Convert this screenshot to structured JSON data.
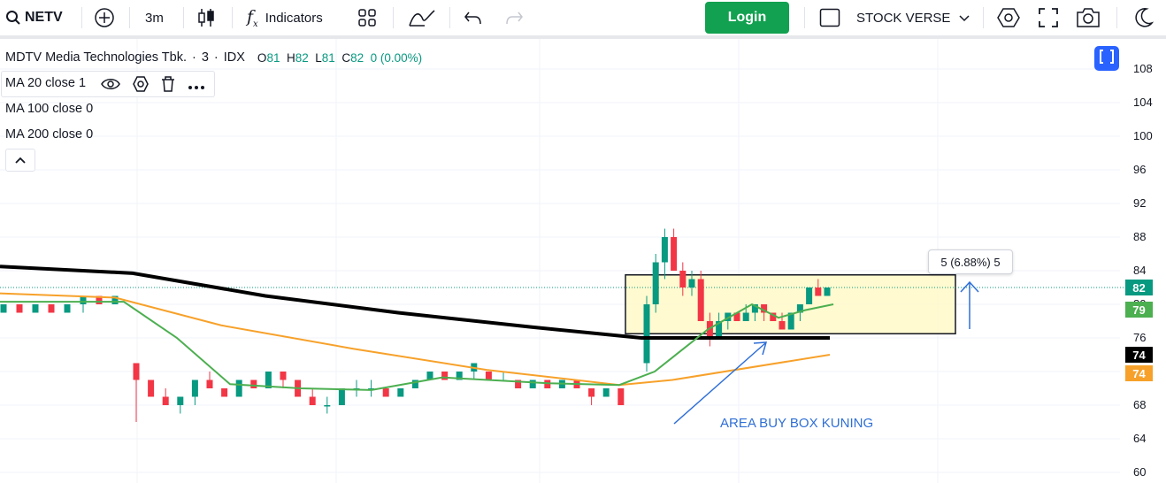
{
  "toolbar": {
    "symbol": "NETV",
    "interval": "3m",
    "indicators_label": "Indicators",
    "login_label": "Login",
    "layout_name": "STOCK VERSE",
    "icons": [
      "search-icon",
      "add-symbol-icon",
      "candles-icon",
      "fx-icon",
      "templates-icon",
      "drawing-icon",
      "undo-icon",
      "redo-icon",
      "square-icon",
      "chevron-down-icon",
      "settings-hexagon-icon",
      "fullscreen-icon",
      "camera-icon",
      "theme-moon-icon"
    ]
  },
  "legend": {
    "name": "MDTV Media Technologies Tbk.",
    "sep1": "·",
    "interval": "3",
    "sep2": "·",
    "exchange": "IDX",
    "o_key": "O",
    "o_val": "81",
    "h_key": "H",
    "h_val": "82",
    "l_key": "L",
    "l_val": "81",
    "c_key": "C",
    "c_val": "82",
    "change": "0 (0.00%)",
    "ma1": "MA 20 close 1",
    "ma2": "MA 100 close 0",
    "ma3": "MA 200 close 0"
  },
  "price_axis": [
    "108",
    "104",
    "100",
    "96",
    "92",
    "88",
    "84",
    "80",
    "76",
    "72",
    "68",
    "64",
    "60"
  ],
  "badges": {
    "last": "82",
    "ma20": "79",
    "ma200": "74",
    "ma100": "74"
  },
  "colors": {
    "up": "#089981",
    "down": "#f23645",
    "ma20": "#4caf50",
    "ma100": "#f7a12a",
    "ma200": "#000000",
    "box_fill": "#fff9c4",
    "annotation": "#2f6fd6",
    "login": "#12a150"
  },
  "measure_label": "5 (6.88%) 5",
  "annotation_text": "AREA BUY BOX KUNING",
  "chart_data": {
    "type": "candlestick",
    "price_range": [
      60,
      108
    ],
    "ma20_last": 79,
    "ma100_last": 74,
    "ma200_last": 74,
    "last_close": 82,
    "buy_box": {
      "low": 76.5,
      "high": 83.5
    },
    "candles": [
      {
        "o": 79,
        "h": 80,
        "l": 79,
        "c": 80
      },
      {
        "o": 80,
        "h": 80,
        "l": 79,
        "c": 79
      },
      {
        "o": 79,
        "h": 80,
        "l": 79,
        "c": 80
      },
      {
        "o": 80,
        "h": 80,
        "l": 79,
        "c": 79
      },
      {
        "o": 79,
        "h": 80,
        "l": 79,
        "c": 80
      },
      {
        "o": 80,
        "h": 81,
        "l": 79,
        "c": 81
      },
      {
        "o": 81,
        "h": 81,
        "l": 80,
        "c": 80
      },
      {
        "o": 80,
        "h": 81,
        "l": 80,
        "c": 81
      },
      {
        "o": 73,
        "h": 73,
        "l": 66,
        "c": 71
      },
      {
        "o": 71,
        "h": 71,
        "l": 69,
        "c": 69
      },
      {
        "o": 69,
        "h": 70,
        "l": 68,
        "c": 68
      },
      {
        "o": 68,
        "h": 69,
        "l": 67,
        "c": 69
      },
      {
        "o": 69,
        "h": 71,
        "l": 68,
        "c": 71
      },
      {
        "o": 71,
        "h": 72,
        "l": 70,
        "c": 70
      },
      {
        "o": 70,
        "h": 70,
        "l": 69,
        "c": 69
      },
      {
        "o": 69,
        "h": 71,
        "l": 69,
        "c": 71
      },
      {
        "o": 71,
        "h": 71,
        "l": 70,
        "c": 70
      },
      {
        "o": 70,
        "h": 72,
        "l": 70,
        "c": 72
      },
      {
        "o": 72,
        "h": 72,
        "l": 70,
        "c": 71
      },
      {
        "o": 71,
        "h": 71,
        "l": 69,
        "c": 69
      },
      {
        "o": 69,
        "h": 70,
        "l": 68,
        "c": 68
      },
      {
        "o": 68,
        "h": 69,
        "l": 67,
        "c": 68
      },
      {
        "o": 68,
        "h": 70,
        "l": 68,
        "c": 70
      },
      {
        "o": 70,
        "h": 71,
        "l": 69,
        "c": 70
      },
      {
        "o": 70,
        "h": 71,
        "l": 69,
        "c": 70
      },
      {
        "o": 70,
        "h": 70,
        "l": 69,
        "c": 69
      },
      {
        "o": 69,
        "h": 70,
        "l": 69,
        "c": 70
      },
      {
        "o": 70,
        "h": 71,
        "l": 70,
        "c": 71
      },
      {
        "o": 71,
        "h": 72,
        "l": 71,
        "c": 72
      },
      {
        "o": 72,
        "h": 72,
        "l": 71,
        "c": 71
      },
      {
        "o": 71,
        "h": 72,
        "l": 71,
        "c": 72
      },
      {
        "o": 72,
        "h": 73,
        "l": 71,
        "c": 73
      },
      {
        "o": 72,
        "h": 72,
        "l": 71,
        "c": 71
      },
      {
        "o": 71,
        "h": 72,
        "l": 71,
        "c": 71
      },
      {
        "o": 71,
        "h": 71,
        "l": 70,
        "c": 70
      },
      {
        "o": 70,
        "h": 71,
        "l": 70,
        "c": 71
      },
      {
        "o": 71,
        "h": 71,
        "l": 70,
        "c": 70
      },
      {
        "o": 70,
        "h": 71,
        "l": 70,
        "c": 71
      },
      {
        "o": 71,
        "h": 71,
        "l": 70,
        "c": 70
      },
      {
        "o": 70,
        "h": 70,
        "l": 68,
        "c": 69
      },
      {
        "o": 69,
        "h": 70,
        "l": 69,
        "c": 70
      },
      {
        "o": 70,
        "h": 70,
        "l": 68,
        "c": 68
      },
      {
        "o": 73,
        "h": 81,
        "l": 72,
        "c": 80
      },
      {
        "o": 80,
        "h": 86,
        "l": 79,
        "c": 85
      },
      {
        "o": 85,
        "h": 89,
        "l": 83,
        "c": 88
      },
      {
        "o": 88,
        "h": 89,
        "l": 84,
        "c": 84
      },
      {
        "o": 84,
        "h": 85,
        "l": 81,
        "c": 82
      },
      {
        "o": 82,
        "h": 84,
        "l": 81,
        "c": 83
      },
      {
        "o": 83,
        "h": 84,
        "l": 78,
        "c": 78
      },
      {
        "o": 78,
        "h": 79,
        "l": 75,
        "c": 76
      },
      {
        "o": 76,
        "h": 79,
        "l": 76,
        "c": 78
      },
      {
        "o": 78,
        "h": 79,
        "l": 77,
        "c": 79
      },
      {
        "o": 79,
        "h": 79,
        "l": 78,
        "c": 78
      },
      {
        "o": 78,
        "h": 80,
        "l": 78,
        "c": 79
      },
      {
        "o": 79,
        "h": 80,
        "l": 78,
        "c": 80
      },
      {
        "o": 80,
        "h": 80,
        "l": 78,
        "c": 79
      },
      {
        "o": 79,
        "h": 79,
        "l": 78,
        "c": 78
      },
      {
        "o": 78,
        "h": 79,
        "l": 77,
        "c": 77
      },
      {
        "o": 77,
        "h": 79,
        "l": 77,
        "c": 79
      },
      {
        "o": 79,
        "h": 80,
        "l": 78,
        "c": 80
      },
      {
        "o": 80,
        "h": 82,
        "l": 80,
        "c": 82
      },
      {
        "o": 82,
        "h": 83,
        "l": 81,
        "c": 81
      },
      {
        "o": 81,
        "h": 82,
        "l": 81,
        "c": 82
      }
    ]
  }
}
